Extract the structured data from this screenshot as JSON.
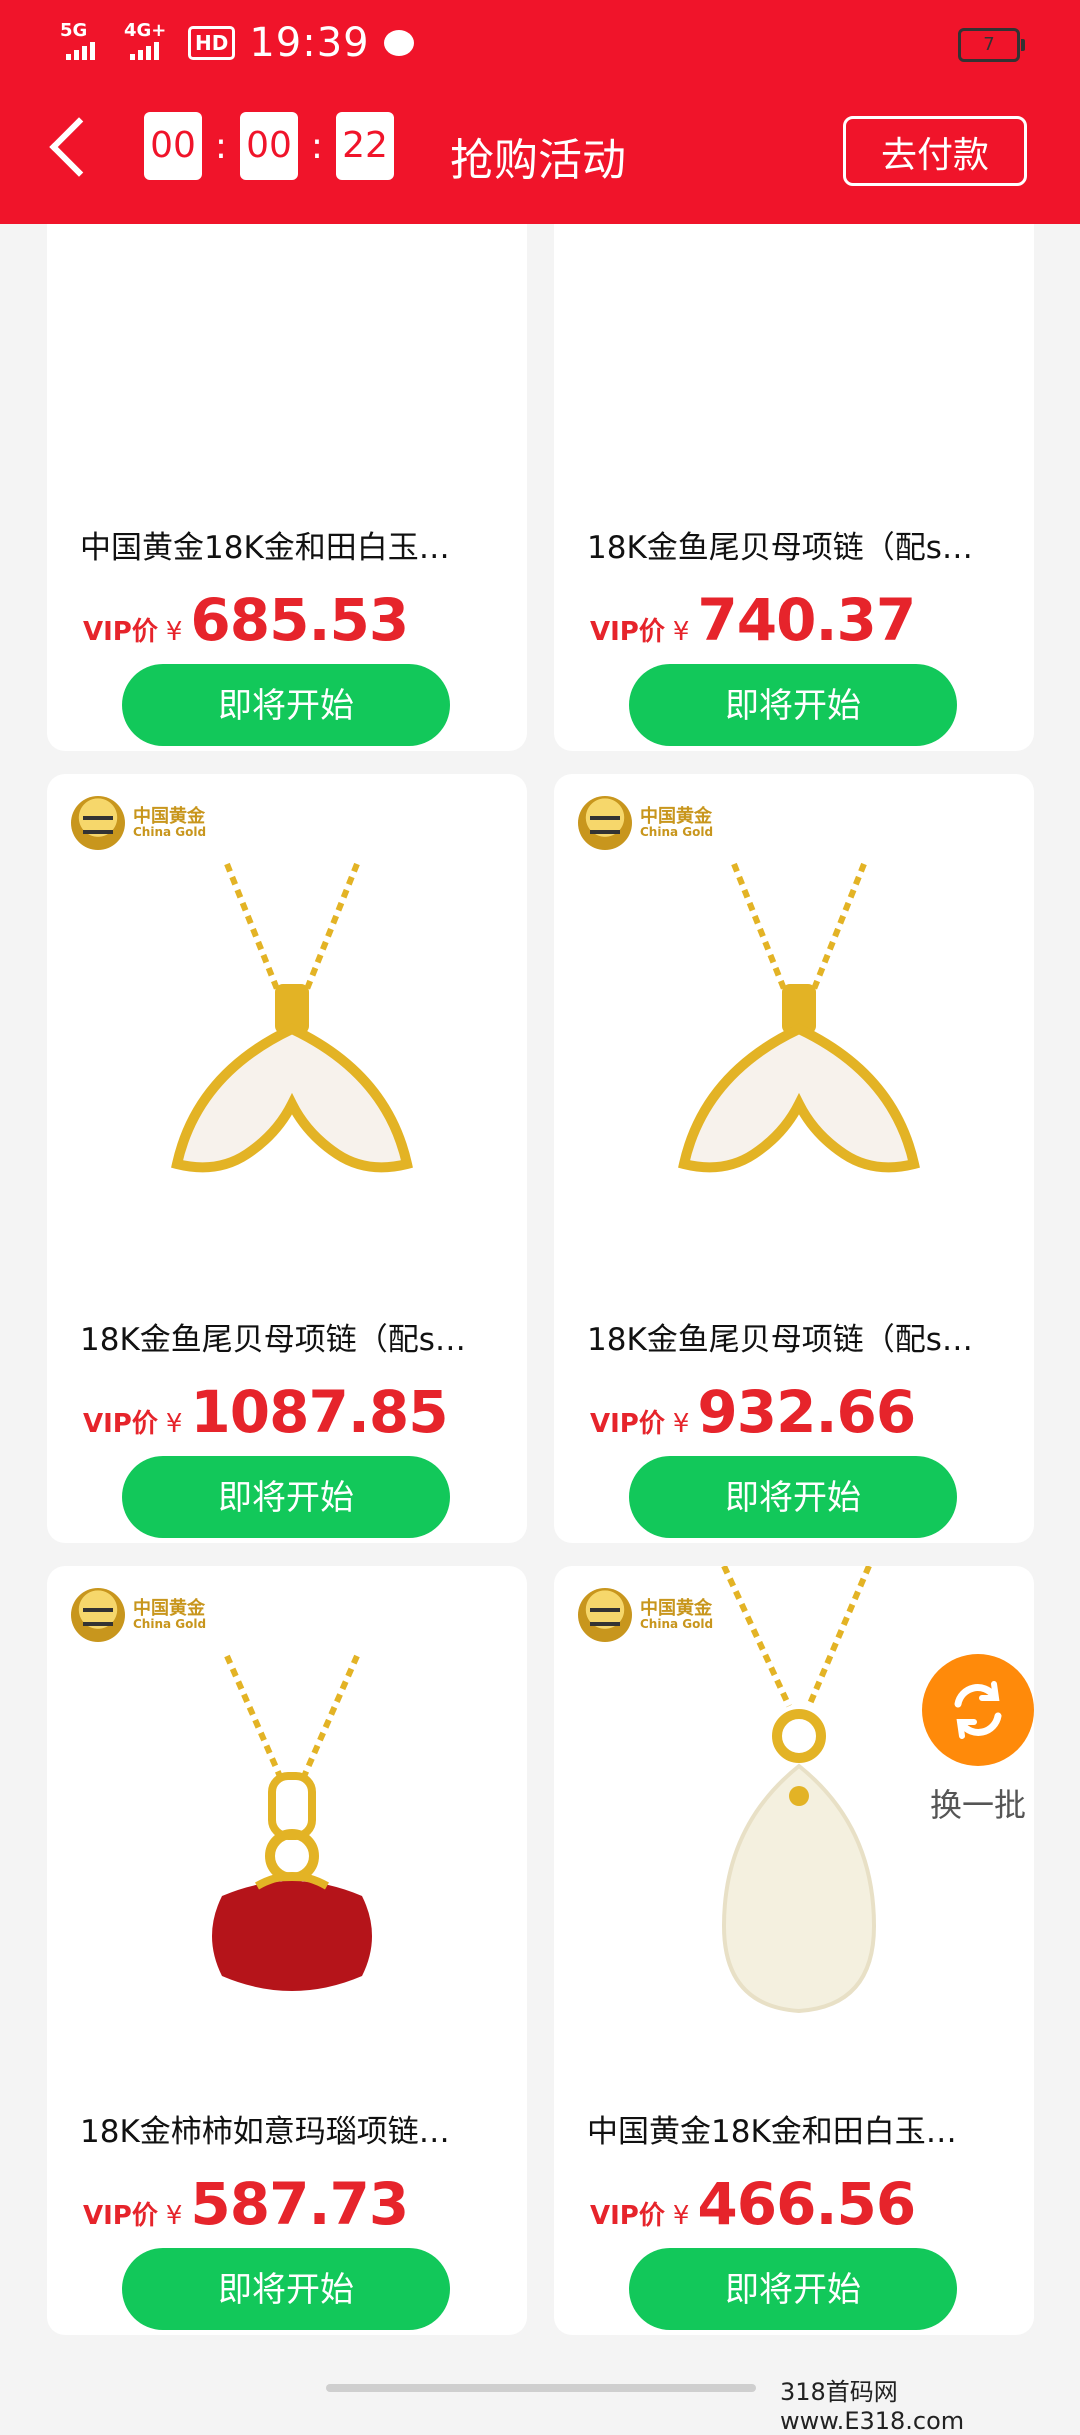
{
  "status_bar": {
    "signal1": "5G",
    "signal2": "4G+",
    "hd_badge": "HD",
    "time": "19:39",
    "battery": "7"
  },
  "header": {
    "timer": [
      "00",
      "00",
      "22"
    ],
    "title": "抢购活动",
    "pay_button": "去付款"
  },
  "products": [
    {
      "name": "中国黄金18K金和田白玉…",
      "vip": "VIP价",
      "currency": "¥",
      "price": "685.53",
      "button": "即将开始"
    },
    {
      "name": "18K金鱼尾贝母项链（配s…",
      "vip": "VIP价",
      "currency": "¥",
      "price": "740.37",
      "button": "即将开始"
    },
    {
      "name": "18K金鱼尾贝母项链（配s…",
      "vip": "VIP价",
      "currency": "¥",
      "price": "1087.85",
      "button": "即将开始",
      "logo_cn": "中国黄金",
      "logo_en": "China Gold"
    },
    {
      "name": "18K金鱼尾贝母项链（配s…",
      "vip": "VIP价",
      "currency": "¥",
      "price": "932.66",
      "button": "即将开始",
      "logo_cn": "中国黄金",
      "logo_en": "China Gold"
    },
    {
      "name": "18K金柿柿如意玛瑙项链…",
      "vip": "VIP价",
      "currency": "¥",
      "price": "587.73",
      "button": "即将开始",
      "logo_cn": "中国黄金",
      "logo_en": "China Gold"
    },
    {
      "name": "中国黄金18K金和田白玉…",
      "vip": "VIP价",
      "currency": "¥",
      "price": "466.56",
      "button": "即将开始",
      "logo_cn": "中国黄金",
      "logo_en": "China Gold"
    }
  ],
  "refresh": {
    "label": "换一批"
  },
  "watermark": "318首码网 www.E318.com"
}
